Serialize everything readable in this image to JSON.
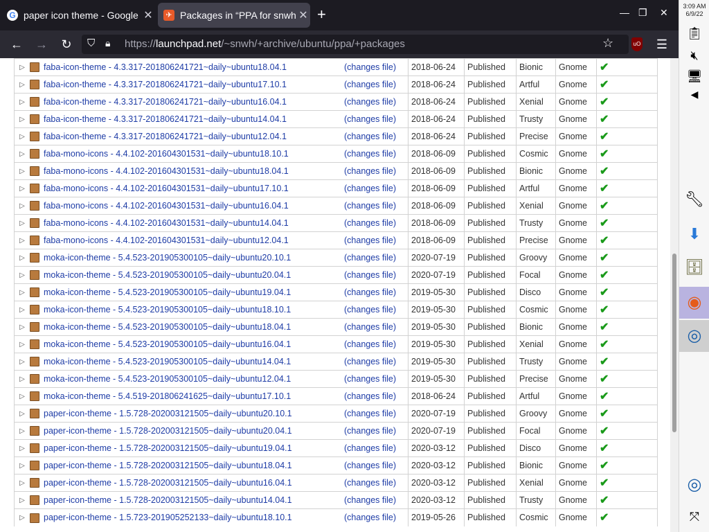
{
  "tabs": [
    {
      "title": "paper icon theme - Google",
      "favicon": "google-icon"
    },
    {
      "title": "Packages in “PPA for snwh”",
      "favicon": "launchpad-icon"
    }
  ],
  "address": {
    "scheme": "https://",
    "host": "launchpad.net",
    "path": "/~snwh/+archive/ubuntu/ppa/+packages"
  },
  "clock": {
    "time": "3:09 AM",
    "date": "6/9/22"
  },
  "rows": [
    {
      "name": "faba-icon-theme - 4.3.317-201806241721~daily~ubuntu18.04.1",
      "changes": "(changes file)",
      "date": "2018-06-24",
      "status": "Published",
      "series": "Bionic",
      "section": "Gnome"
    },
    {
      "name": "faba-icon-theme - 4.3.317-201806241721~daily~ubuntu17.10.1",
      "changes": "(changes file)",
      "date": "2018-06-24",
      "status": "Published",
      "series": "Artful",
      "section": "Gnome"
    },
    {
      "name": "faba-icon-theme - 4.3.317-201806241721~daily~ubuntu16.04.1",
      "changes": "(changes file)",
      "date": "2018-06-24",
      "status": "Published",
      "series": "Xenial",
      "section": "Gnome"
    },
    {
      "name": "faba-icon-theme - 4.3.317-201806241721~daily~ubuntu14.04.1",
      "changes": "(changes file)",
      "date": "2018-06-24",
      "status": "Published",
      "series": "Trusty",
      "section": "Gnome"
    },
    {
      "name": "faba-icon-theme - 4.3.317-201806241721~daily~ubuntu12.04.1",
      "changes": "(changes file)",
      "date": "2018-06-24",
      "status": "Published",
      "series": "Precise",
      "section": "Gnome"
    },
    {
      "name": "faba-mono-icons - 4.4.102-201604301531~daily~ubuntu18.10.1",
      "changes": "(changes file)",
      "date": "2018-06-09",
      "status": "Published",
      "series": "Cosmic",
      "section": "Gnome"
    },
    {
      "name": "faba-mono-icons - 4.4.102-201604301531~daily~ubuntu18.04.1",
      "changes": "(changes file)",
      "date": "2018-06-09",
      "status": "Published",
      "series": "Bionic",
      "section": "Gnome"
    },
    {
      "name": "faba-mono-icons - 4.4.102-201604301531~daily~ubuntu17.10.1",
      "changes": "(changes file)",
      "date": "2018-06-09",
      "status": "Published",
      "series": "Artful",
      "section": "Gnome"
    },
    {
      "name": "faba-mono-icons - 4.4.102-201604301531~daily~ubuntu16.04.1",
      "changes": "(changes file)",
      "date": "2018-06-09",
      "status": "Published",
      "series": "Xenial",
      "section": "Gnome"
    },
    {
      "name": "faba-mono-icons - 4.4.102-201604301531~daily~ubuntu14.04.1",
      "changes": "(changes file)",
      "date": "2018-06-09",
      "status": "Published",
      "series": "Trusty",
      "section": "Gnome"
    },
    {
      "name": "faba-mono-icons - 4.4.102-201604301531~daily~ubuntu12.04.1",
      "changes": "(changes file)",
      "date": "2018-06-09",
      "status": "Published",
      "series": "Precise",
      "section": "Gnome"
    },
    {
      "name": "moka-icon-theme - 5.4.523-201905300105~daily~ubuntu20.10.1",
      "changes": "(changes file)",
      "date": "2020-07-19",
      "status": "Published",
      "series": "Groovy",
      "section": "Gnome"
    },
    {
      "name": "moka-icon-theme - 5.4.523-201905300105~daily~ubuntu20.04.1",
      "changes": "(changes file)",
      "date": "2020-07-19",
      "status": "Published",
      "series": "Focal",
      "section": "Gnome"
    },
    {
      "name": "moka-icon-theme - 5.4.523-201905300105~daily~ubuntu19.04.1",
      "changes": "(changes file)",
      "date": "2019-05-30",
      "status": "Published",
      "series": "Disco",
      "section": "Gnome"
    },
    {
      "name": "moka-icon-theme - 5.4.523-201905300105~daily~ubuntu18.10.1",
      "changes": "(changes file)",
      "date": "2019-05-30",
      "status": "Published",
      "series": "Cosmic",
      "section": "Gnome"
    },
    {
      "name": "moka-icon-theme - 5.4.523-201905300105~daily~ubuntu18.04.1",
      "changes": "(changes file)",
      "date": "2019-05-30",
      "status": "Published",
      "series": "Bionic",
      "section": "Gnome"
    },
    {
      "name": "moka-icon-theme - 5.4.523-201905300105~daily~ubuntu16.04.1",
      "changes": "(changes file)",
      "date": "2019-05-30",
      "status": "Published",
      "series": "Xenial",
      "section": "Gnome"
    },
    {
      "name": "moka-icon-theme - 5.4.523-201905300105~daily~ubuntu14.04.1",
      "changes": "(changes file)",
      "date": "2019-05-30",
      "status": "Published",
      "series": "Trusty",
      "section": "Gnome"
    },
    {
      "name": "moka-icon-theme - 5.4.523-201905300105~daily~ubuntu12.04.1",
      "changes": "(changes file)",
      "date": "2019-05-30",
      "status": "Published",
      "series": "Precise",
      "section": "Gnome"
    },
    {
      "name": "moka-icon-theme - 5.4.519-201806241625~daily~ubuntu17.10.1",
      "changes": "(changes file)",
      "date": "2018-06-24",
      "status": "Published",
      "series": "Artful",
      "section": "Gnome"
    },
    {
      "name": "paper-icon-theme - 1.5.728-202003121505~daily~ubuntu20.10.1",
      "changes": "(changes file)",
      "date": "2020-07-19",
      "status": "Published",
      "series": "Groovy",
      "section": "Gnome"
    },
    {
      "name": "paper-icon-theme - 1.5.728-202003121505~daily~ubuntu20.04.1",
      "changes": "(changes file)",
      "date": "2020-07-19",
      "status": "Published",
      "series": "Focal",
      "section": "Gnome"
    },
    {
      "name": "paper-icon-theme - 1.5.728-202003121505~daily~ubuntu19.04.1",
      "changes": "(changes file)",
      "date": "2020-03-12",
      "status": "Published",
      "series": "Disco",
      "section": "Gnome"
    },
    {
      "name": "paper-icon-theme - 1.5.728-202003121505~daily~ubuntu18.04.1",
      "changes": "(changes file)",
      "date": "2020-03-12",
      "status": "Published",
      "series": "Bionic",
      "section": "Gnome"
    },
    {
      "name": "paper-icon-theme - 1.5.728-202003121505~daily~ubuntu16.04.1",
      "changes": "(changes file)",
      "date": "2020-03-12",
      "status": "Published",
      "series": "Xenial",
      "section": "Gnome"
    },
    {
      "name": "paper-icon-theme - 1.5.728-202003121505~daily~ubuntu14.04.1",
      "changes": "(changes file)",
      "date": "2020-03-12",
      "status": "Published",
      "series": "Trusty",
      "section": "Gnome"
    },
    {
      "name": "paper-icon-theme - 1.5.723-201905252133~daily~ubuntu18.10.1",
      "changes": "(changes file)",
      "date": "2019-05-26",
      "status": "Published",
      "series": "Cosmic",
      "section": "Gnome"
    }
  ],
  "colors": {
    "link": "#1e3ca6",
    "check": "#1a9a1a",
    "tabbar": "#1c1b22",
    "navbar": "#2b2a33"
  },
  "icons": {
    "row_expand": "triangle-right-icon",
    "package": "package-box-icon",
    "status_ok": "checkmark-icon"
  }
}
